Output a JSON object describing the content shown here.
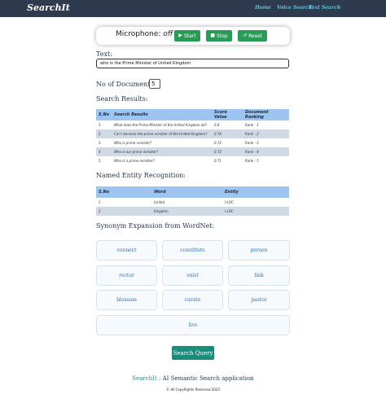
{
  "navbar": {
    "brand": "SearchIt",
    "links": [
      {
        "label": "Home"
      },
      {
        "label": "Voice Search"
      },
      {
        "label": "Text Search"
      }
    ]
  },
  "microphone": {
    "label": "Microphone:",
    "state": "off",
    "buttons": {
      "start": "Start",
      "stop": "Stop",
      "reset": "Reset"
    }
  },
  "text_section": {
    "label": "Text:",
    "value": "who is the Prime Minister of United Kingdom"
  },
  "docs_section": {
    "label": "No of Documents:",
    "value": "5"
  },
  "search_results": {
    "title": "Search Results:",
    "headers": [
      "S.No",
      "Search Results",
      "Score Value",
      "Document Ranking"
    ],
    "rows": [
      [
        "1",
        "What does the Prime Minister of the United Kingdom do?",
        "0.8",
        "Rank - 1"
      ],
      [
        "2",
        "Can I become the prime minister of the United Kingdom?",
        "0.74",
        "Rank - 2"
      ],
      [
        "3",
        "Who is prime minister?",
        "0.72",
        "Rank - 3"
      ],
      [
        "4",
        "Who is our prime minister?",
        "0.72",
        "Rank - 4"
      ],
      [
        "5",
        "Who is a prime minister?",
        "0.71",
        "Rank - 5"
      ]
    ]
  },
  "ner": {
    "title": "Named Entity Recognition:",
    "headers": [
      "S.No",
      "Word",
      "Entity"
    ],
    "rows": [
      [
        "1",
        "United",
        "I-LOC"
      ],
      [
        "2",
        "Kingdom",
        "I-LOC"
      ]
    ]
  },
  "synonyms": {
    "title": "Synonym Expansion from WordNet:",
    "items": [
      "connect",
      "constitute",
      "person",
      "rector",
      "exist",
      "link",
      "blossom",
      "curate",
      "pastor",
      "live"
    ]
  },
  "search_button": "Search Query",
  "footer": {
    "brand": "SearchIt :",
    "tagline": "AI Semantic Search application",
    "copyright": "© All CopyRights Reserved 2023"
  },
  "colors": {
    "navbar_bg": "#2e3a4d",
    "nav_link": "#5ec3dc",
    "mic_button": "#2a9b57",
    "table_header": "#9ec4f2",
    "table_alt_row": "#cfdae4",
    "synonym_text": "#2f6fb6",
    "search_button": "#198d7c"
  },
  "icons": {
    "start": "play-icon",
    "stop": "stop-icon",
    "reset": "reset-icon"
  }
}
